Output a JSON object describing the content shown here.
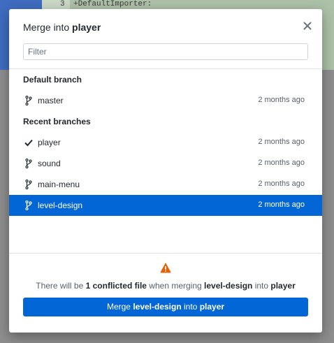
{
  "background": {
    "line_number": "3",
    "code_line": "+DefaultImporter:"
  },
  "dialog": {
    "title_prefix": "Merge into ",
    "title_branch": "player",
    "close_icon": "close-icon"
  },
  "filter": {
    "placeholder": "Filter",
    "value": ""
  },
  "groups": [
    {
      "header": "Default branch"
    },
    {
      "header": "Recent branches"
    }
  ],
  "branches": [
    {
      "name": "master",
      "time": "2 months ago",
      "icon": "branch-icon"
    },
    {
      "name": "player",
      "time": "2 months ago",
      "icon": "check-icon"
    },
    {
      "name": "sound",
      "time": "2 months ago",
      "icon": "branch-icon"
    },
    {
      "name": "main-menu",
      "time": "2 months ago",
      "icon": "branch-icon"
    },
    {
      "name": "level-design",
      "time": "2 months ago",
      "icon": "branch-icon",
      "selected": true
    }
  ],
  "status": {
    "pre": "There will be ",
    "count_text": "1 conflicted file",
    "mid": " when merging ",
    "source": "level-design",
    "into": " into ",
    "target": "player"
  },
  "merge_button": {
    "prefix": "Merge ",
    "source": "level-design",
    "into": " into ",
    "target": "player"
  },
  "colors": {
    "accent": "#0366d6",
    "warning": "#e36209"
  }
}
